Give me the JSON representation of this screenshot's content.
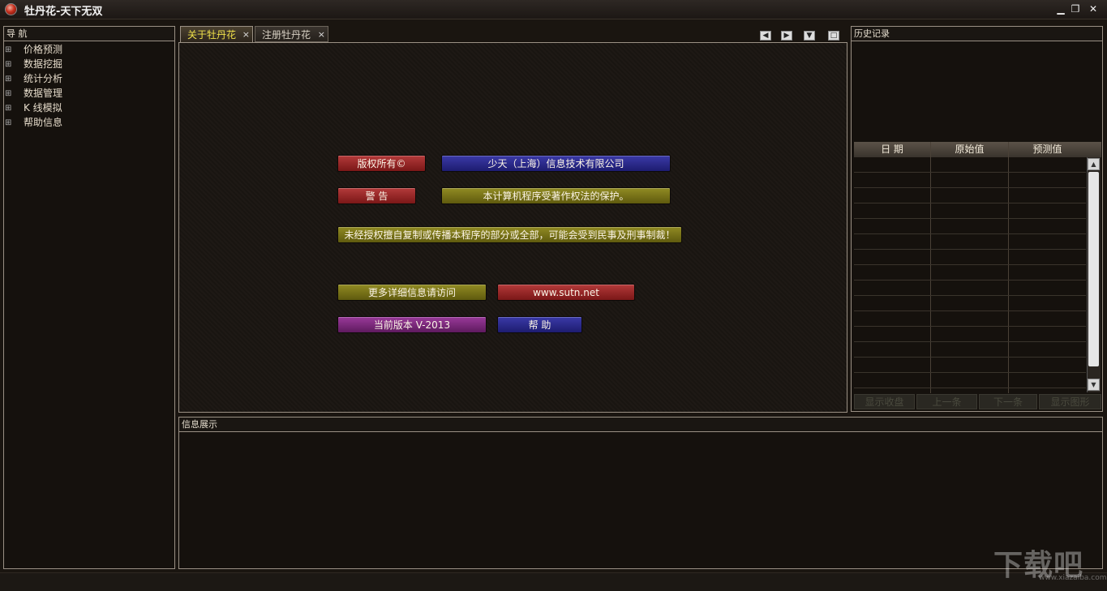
{
  "window": {
    "title": "牡丹花-天下无双",
    "minimize": "▁",
    "restore": "❐",
    "close": "✕"
  },
  "nav": {
    "title": "导 航",
    "items": [
      "价格预测",
      "数据挖掘",
      "统计分析",
      "数据管理",
      "K 线模拟",
      "帮助信息"
    ]
  },
  "tabs": [
    {
      "label": "关于牡丹花",
      "close": "×"
    },
    {
      "label": "注册牡丹花",
      "close": "×"
    }
  ],
  "tab_controls": [
    "◀",
    "▶",
    "▼",
    "□"
  ],
  "about": {
    "copyright_label": "版权所有©",
    "company": "少天（上海）信息技术有限公司",
    "warning_label": "警 告",
    "warning_text": "本计算机程序受著作权法的保护。",
    "legal_text": "未经授权擅自复制或传播本程序的部分或全部，可能会受到民事及刑事制裁！",
    "more_info": "更多详细信息请访问",
    "website": "www.sutn.net",
    "version": "当前版本  V-2013",
    "help": "帮  助"
  },
  "history": {
    "title": "历史记录",
    "columns": [
      "日  期",
      "原始值",
      "预测值"
    ],
    "scroll_up": "▲",
    "scroll_down": "▼",
    "buttons": [
      "显示收盘",
      "上一条",
      "下一条",
      "显示图形"
    ]
  },
  "info": {
    "title": "信息展示"
  },
  "watermark": {
    "brand": "下载吧",
    "url": "www.xiazaiba.com"
  },
  "colors": {
    "background": "#1a1510",
    "active_tab_text": "#f0e14a",
    "red_button": "#9a2828",
    "blue_button": "#2a2a8a",
    "olive_button": "#777219",
    "purple_button": "#7a2a7a"
  }
}
